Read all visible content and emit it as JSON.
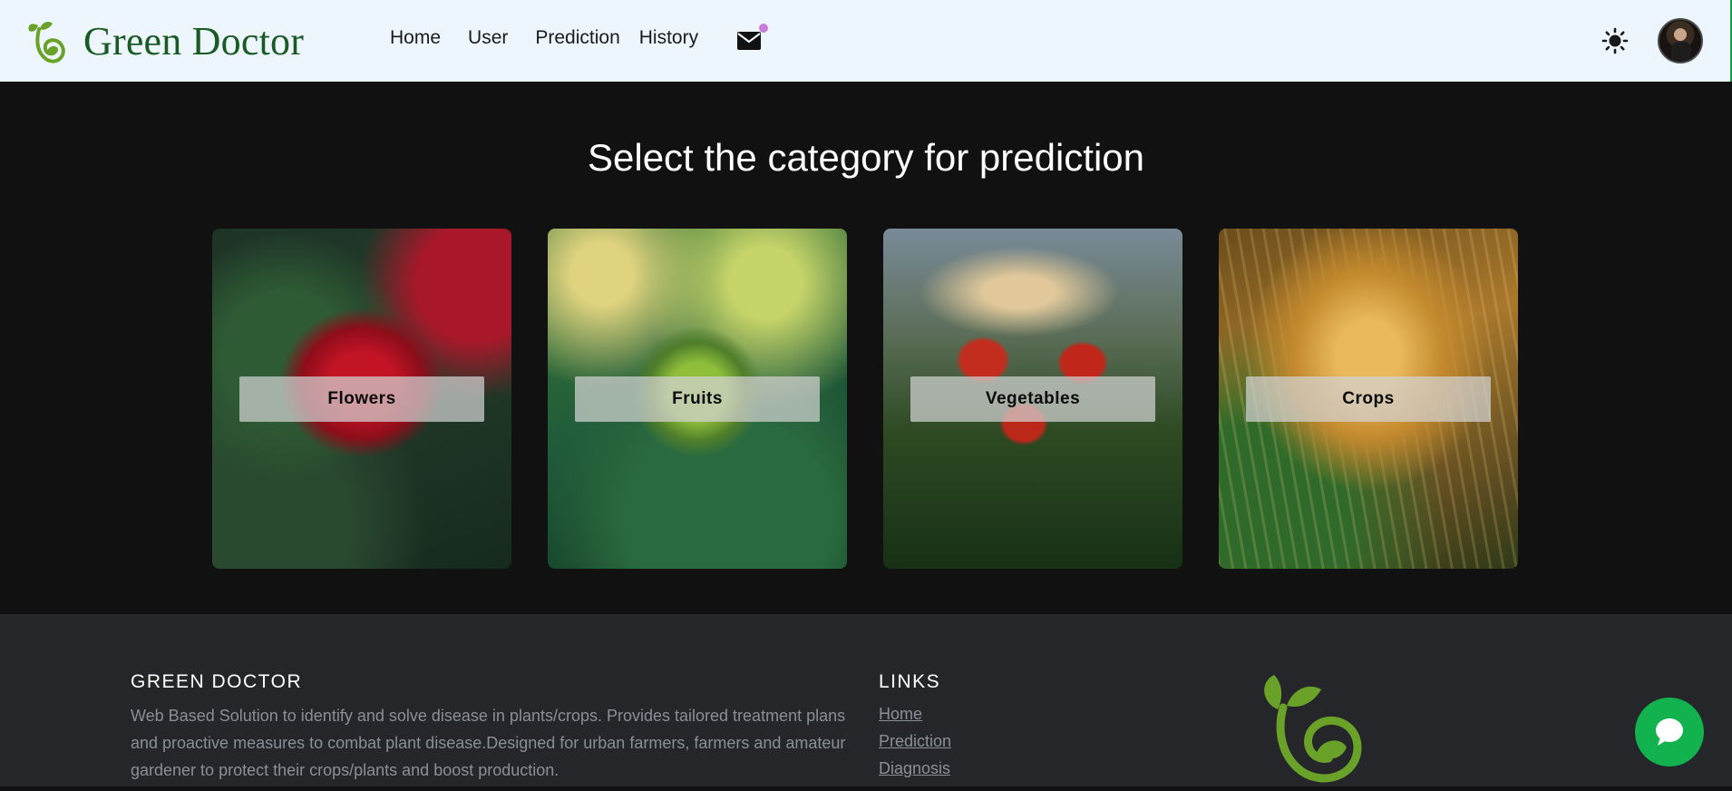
{
  "brand": {
    "name": "Green Doctor",
    "logo_icon": "sprout-leaf-icon"
  },
  "nav": {
    "links": [
      "Home",
      "User",
      "Prediction",
      "History"
    ],
    "mail_icon": "envelope-icon",
    "theme_icon": "sun-icon"
  },
  "main": {
    "heading": "Select the category for prediction",
    "categories": [
      {
        "label": "Flowers",
        "image": "red rose"
      },
      {
        "label": "Fruits",
        "image": "green apple"
      },
      {
        "label": "Vegetables",
        "image": "tomato plant"
      },
      {
        "label": "Crops",
        "image": "wheat"
      }
    ]
  },
  "footer": {
    "title": "GREEN DOCTOR",
    "description": "Web Based Solution to identify and solve disease in plants/crops. Provides tailored treatment plans and proactive measures to combat plant disease.Designed for urban farmers, farmers and amateur gardener to protect their crops/plants and boost production.",
    "links_title": "LINKS",
    "links": [
      "Home",
      "Prediction",
      "Diagnosis"
    ]
  },
  "chat": {
    "icon": "chat-bubble-icon"
  },
  "colors": {
    "nav_bg": "#eef6fd",
    "brand_green": "#1a5a25",
    "leaf_green": "#6aa128",
    "main_bg": "#111111",
    "footer_bg": "#25262a",
    "chat_green": "#12b34f",
    "notification_dot": "#c87dd9"
  }
}
